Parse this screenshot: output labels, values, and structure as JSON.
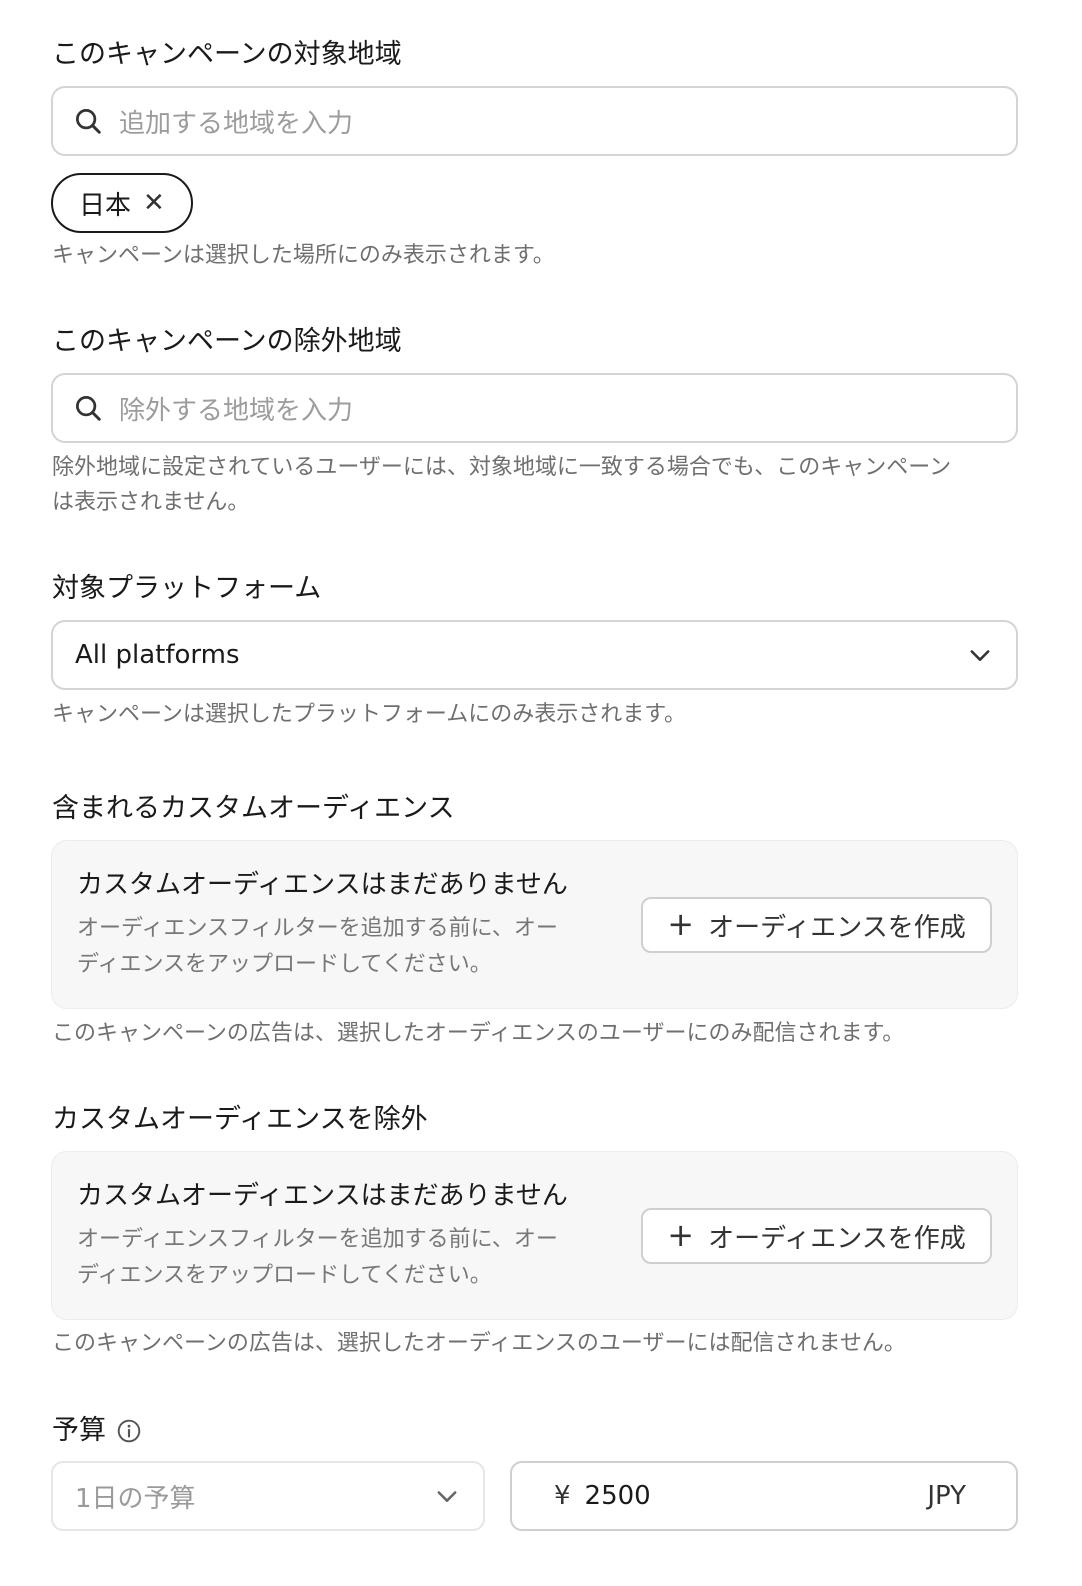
{
  "target_region": {
    "label": "このキャンペーンの対象地域",
    "placeholder": "追加する地域を入力",
    "chips": [
      {
        "label": "日本",
        "remove_glyph": "✕"
      }
    ],
    "helper": "キャンペーンは選択した場所にのみ表示されます。"
  },
  "excluded_region": {
    "label": "このキャンペーンの除外地域",
    "placeholder": "除外する地域を入力",
    "helper_line1": "除外地域に設定されているユーザーには、対象地域に一致する場合でも、このキャンペーン",
    "helper_line2": "は表示されません。"
  },
  "platform": {
    "label": "対象プラットフォーム",
    "selected": "All platforms",
    "helper": "キャンペーンは選択したプラットフォームにのみ表示されます。"
  },
  "included_audience": {
    "label": "含まれるカスタムオーディエンス",
    "empty_title": "カスタムオーディエンスはまだありません",
    "empty_desc_line1": "オーディエンスフィルターを追加する前に、オー",
    "empty_desc_line2": "ディエンスをアップロードしてください。",
    "create_button": "オーディエンスを作成",
    "helper": "このキャンペーンの広告は、選択したオーディエンスのユーザーにのみ配信されます。"
  },
  "excluded_audience": {
    "label": "カスタムオーディエンスを除外",
    "empty_title": "カスタムオーディエンスはまだありません",
    "empty_desc_line1": "オーディエンスフィルターを追加する前に、オー",
    "empty_desc_line2": "ディエンスをアップロードしてください。",
    "create_button": "オーディエンスを作成",
    "helper": "このキャンペーンの広告は、選択したオーディエンスのユーザーには配信されません。"
  },
  "budget": {
    "label": "予算",
    "type_selected": "1日の予算",
    "currency_symbol": "¥",
    "amount": "2500",
    "currency_code": "JPY"
  },
  "icons": {
    "search": "search-icon",
    "chevron": "chevron-down-icon",
    "info": "info-icon",
    "plus": "plus-icon",
    "close": "close-icon"
  },
  "colors": {
    "text": "#1a1a1a",
    "muted": "#6f6f6f",
    "border": "#d4d4d4",
    "panel_bg": "#f7f7f7"
  }
}
